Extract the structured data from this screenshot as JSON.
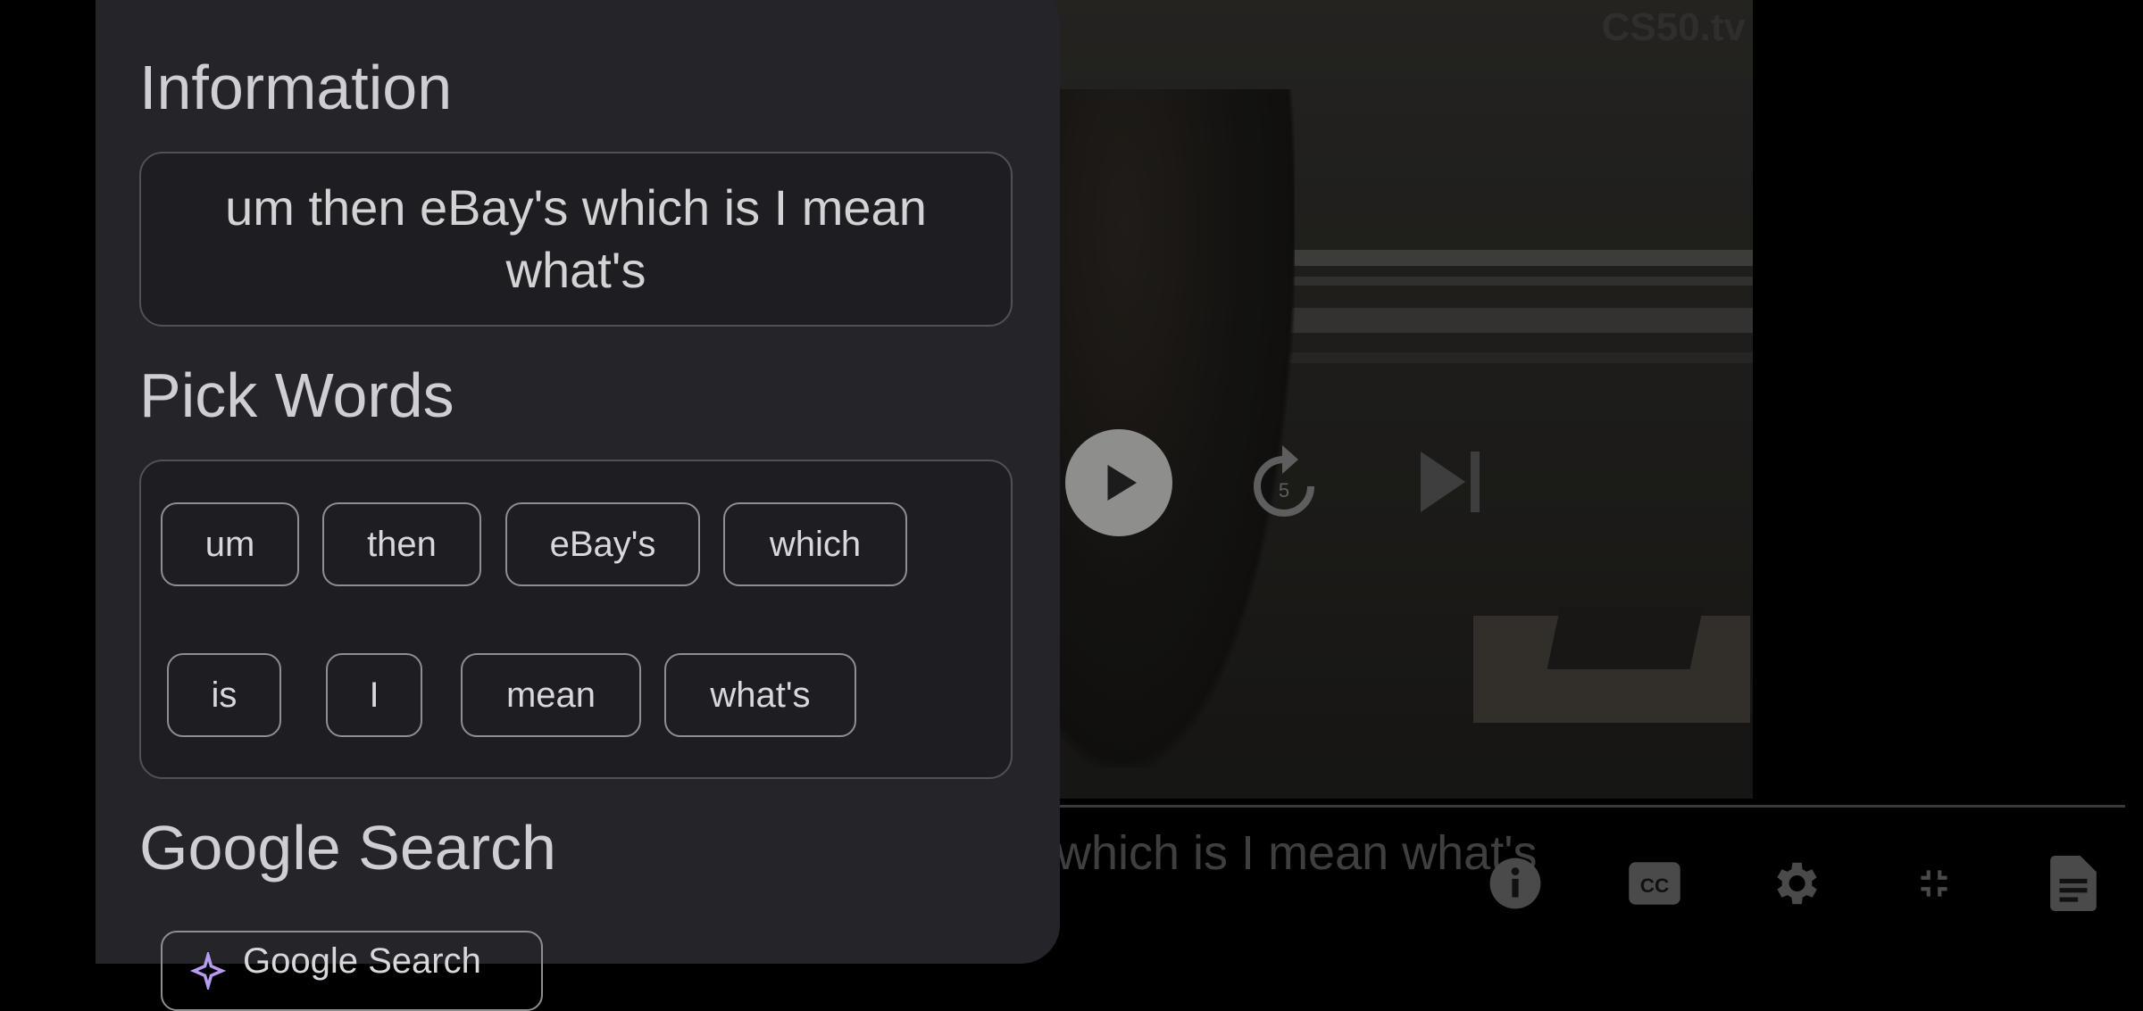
{
  "panel": {
    "information_title": "Information",
    "information_text": "um then eBay's which is I mean what's",
    "pick_words_title": "Pick Words",
    "words": [
      "um",
      "then",
      "eBay's",
      "which",
      "is",
      "I",
      "mean",
      "what's"
    ],
    "google_search_title": "Google Search",
    "google_search_button": "Google Search"
  },
  "video": {
    "watermark": "CS50.tv",
    "subtitle": "which is I mean what's",
    "replay_seconds": "5"
  },
  "icons": {
    "play": "play-icon",
    "replay": "replay-5-icon",
    "next": "skip-next-icon",
    "info": "info-icon",
    "cc": "closed-captions-icon",
    "settings": "gear-icon",
    "exit_fullscreen": "exit-fullscreen-icon",
    "transcript": "document-icon",
    "google": "ai-sparkle-icon"
  },
  "colors": {
    "panel_bg": "#252529",
    "chip_border": "#8e8e93",
    "accent": "#b79cf0"
  }
}
